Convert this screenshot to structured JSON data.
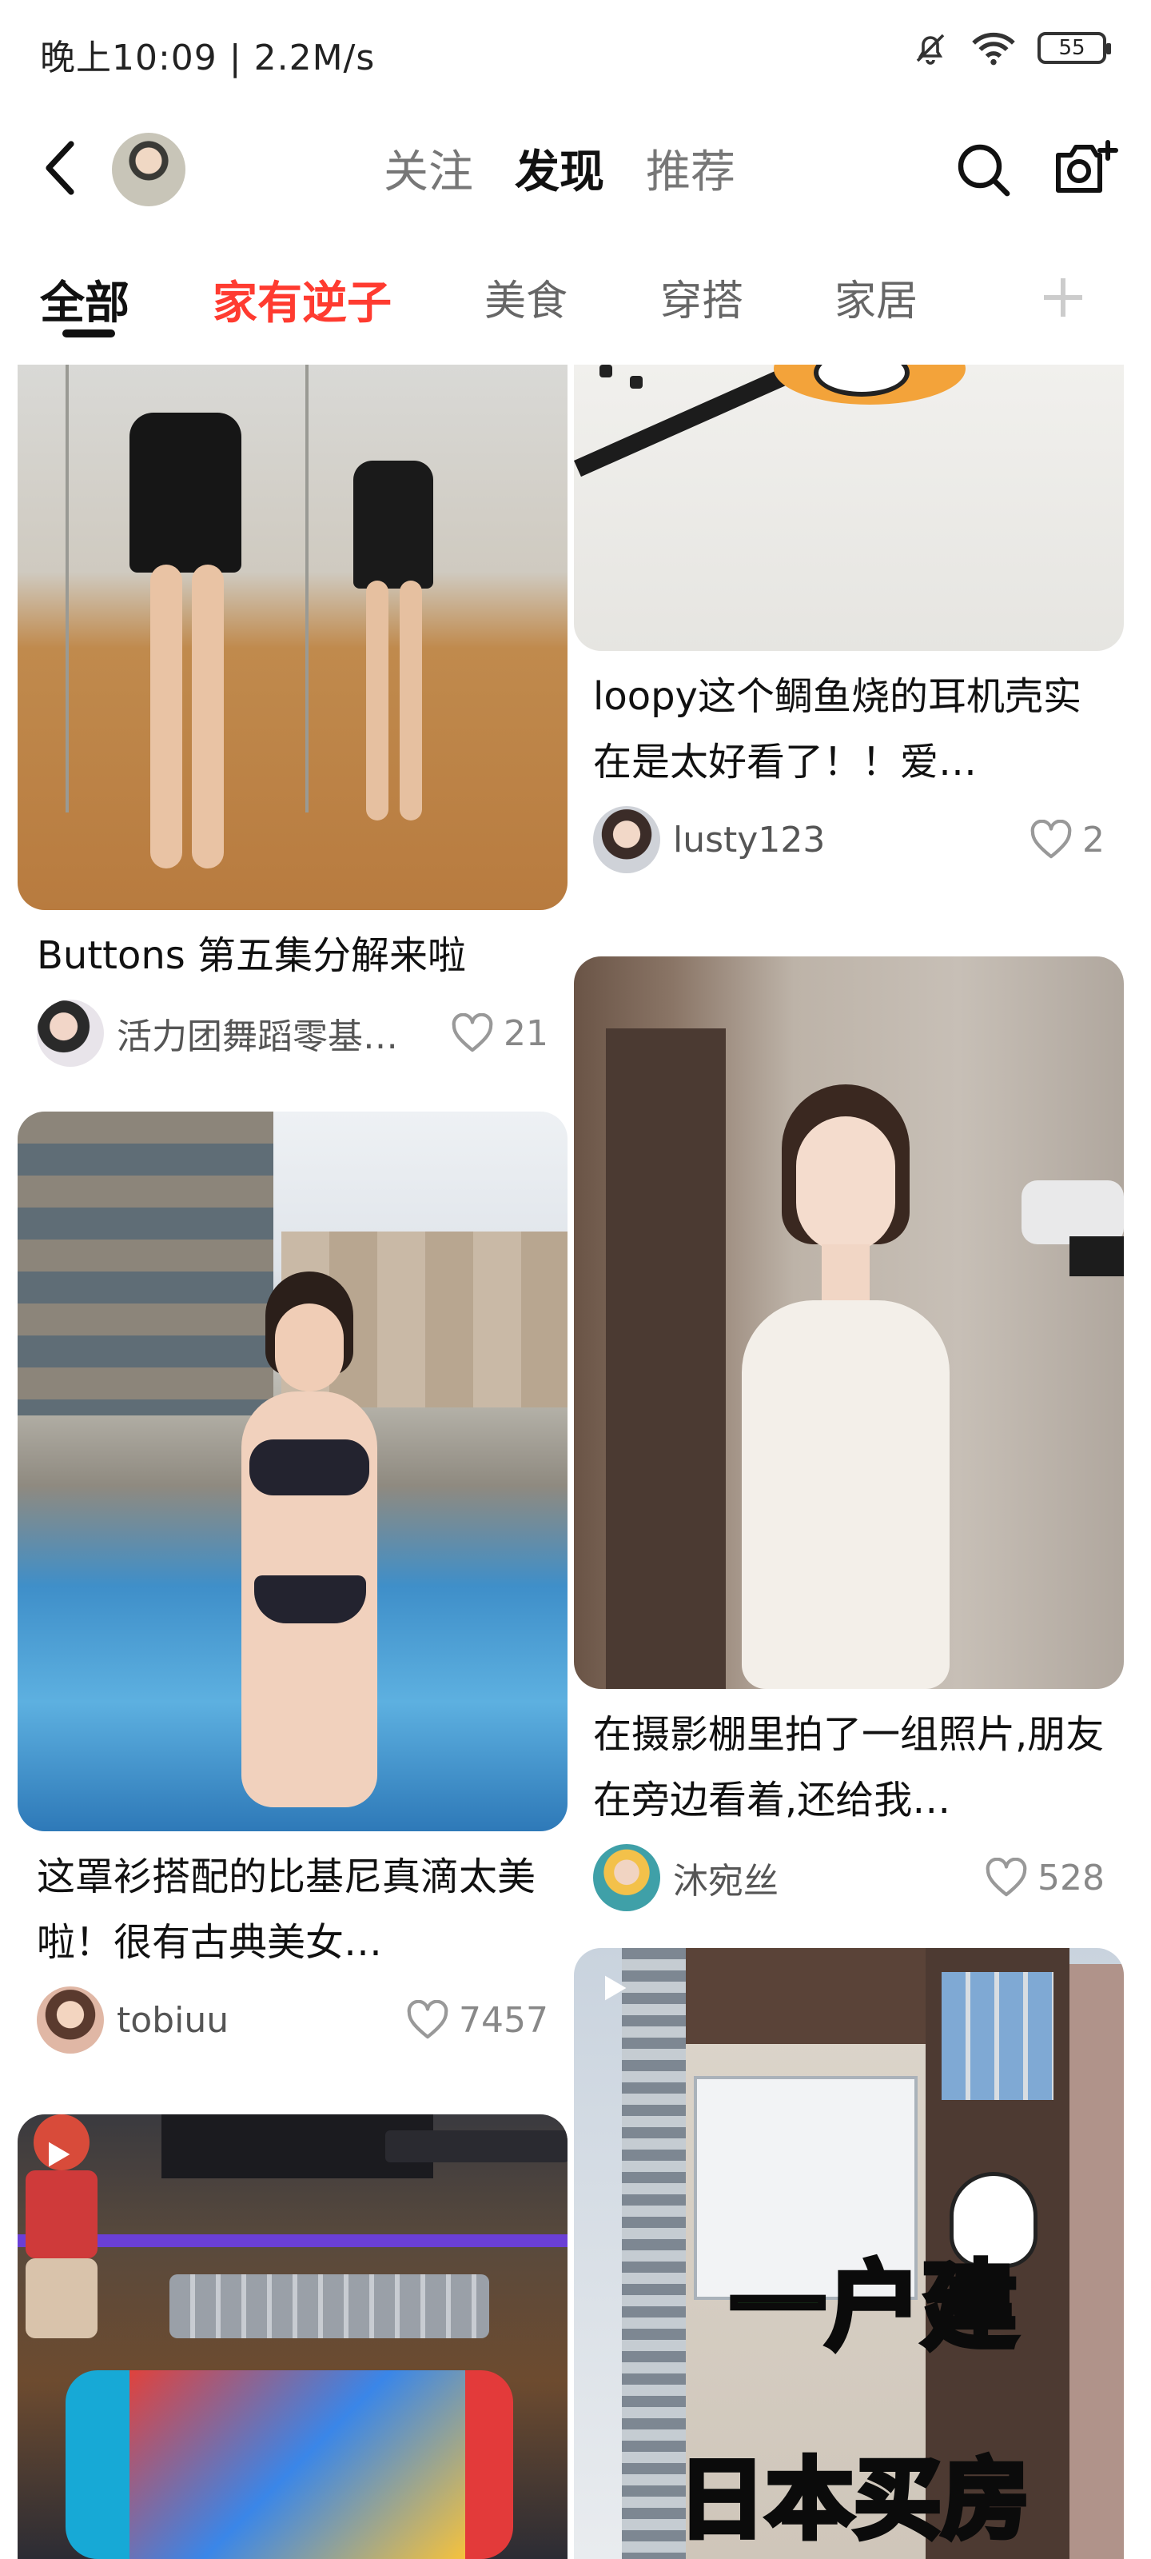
{
  "status": {
    "time": "晚上10:09 | 2.2M/s",
    "battery": "55"
  },
  "header": {
    "tabs": [
      "关注",
      "发现",
      "推荐"
    ],
    "active_tab": "发现"
  },
  "categories": {
    "items": [
      "全部",
      "家有逆子",
      "美食",
      "穿搭",
      "家居"
    ],
    "active": "全部",
    "highlight": "家有逆子"
  },
  "colors": {
    "accent": "#ff3b30",
    "text_primary": "#111111",
    "text_secondary": "#555555",
    "text_muted": "#888888"
  },
  "feed": {
    "left": [
      {
        "title": "Buttons 第五集分解来啦",
        "author": "活力团舞蹈零基…",
        "likes": "21"
      },
      {
        "title": "这罩衫搭配的比基尼真滴太美啦！很有古典美女…",
        "author": "tobiuu",
        "likes": "7457"
      },
      {
        "title": "",
        "author": "",
        "likes": ""
      }
    ],
    "right": [
      {
        "title": "loopy这个鲷鱼烧的耳机壳实在是太好看了！！爱…",
        "author": "lusty123",
        "likes": "2"
      },
      {
        "title": "在摄影棚里拍了一组照片,朋友在旁边看着,还给我…",
        "author": "沐宛丝",
        "likes": "528"
      },
      {
        "title": "",
        "author": "",
        "likes": "",
        "overlay_line1": "一户建",
        "overlay_line2": "日本买房"
      }
    ]
  }
}
